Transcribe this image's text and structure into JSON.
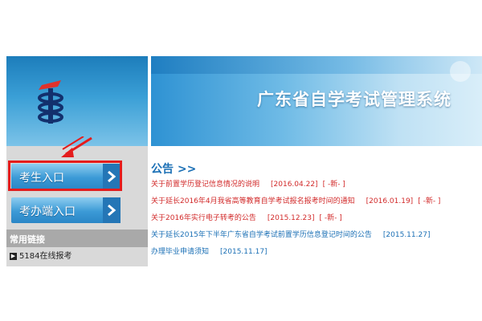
{
  "header": {
    "title": "广东省自学考试管理系统"
  },
  "sidebar": {
    "buttons": [
      {
        "label": "考生入口"
      },
      {
        "label": "考办端入口"
      }
    ],
    "section_title": "常用链接",
    "links": [
      {
        "label": "5184在线报考"
      }
    ]
  },
  "notices": {
    "title": "公告 >>",
    "items": [
      {
        "text": "关于前置学历登记信息情况的说明",
        "date": "[2016.04.22]",
        "badge": "[ -新- ]",
        "color": "red"
      },
      {
        "text": "关于延长2016年4月我省高等教育自学考试报名报考时间的通知",
        "date": "[2016.01.19]",
        "badge": "[ -新- ]",
        "color": "red"
      },
      {
        "text": "关于2016年实行电子转考的公告",
        "date": "[2015.12.23]",
        "badge": "[ -新- ]",
        "color": "red"
      },
      {
        "text": "关于延长2015年下半年广东省自学考试前置学历信息登记时间的公告",
        "date": "[2015.11.27]",
        "badge": "",
        "color": "blue"
      },
      {
        "text": "办理毕业申请须知",
        "date": "[2015.11.17]",
        "badge": "",
        "color": "blue"
      }
    ]
  },
  "colors": {
    "accent_blue": "#1a6fb5",
    "notice_red": "#d22a2a",
    "highlight_red": "#e41c1c"
  }
}
